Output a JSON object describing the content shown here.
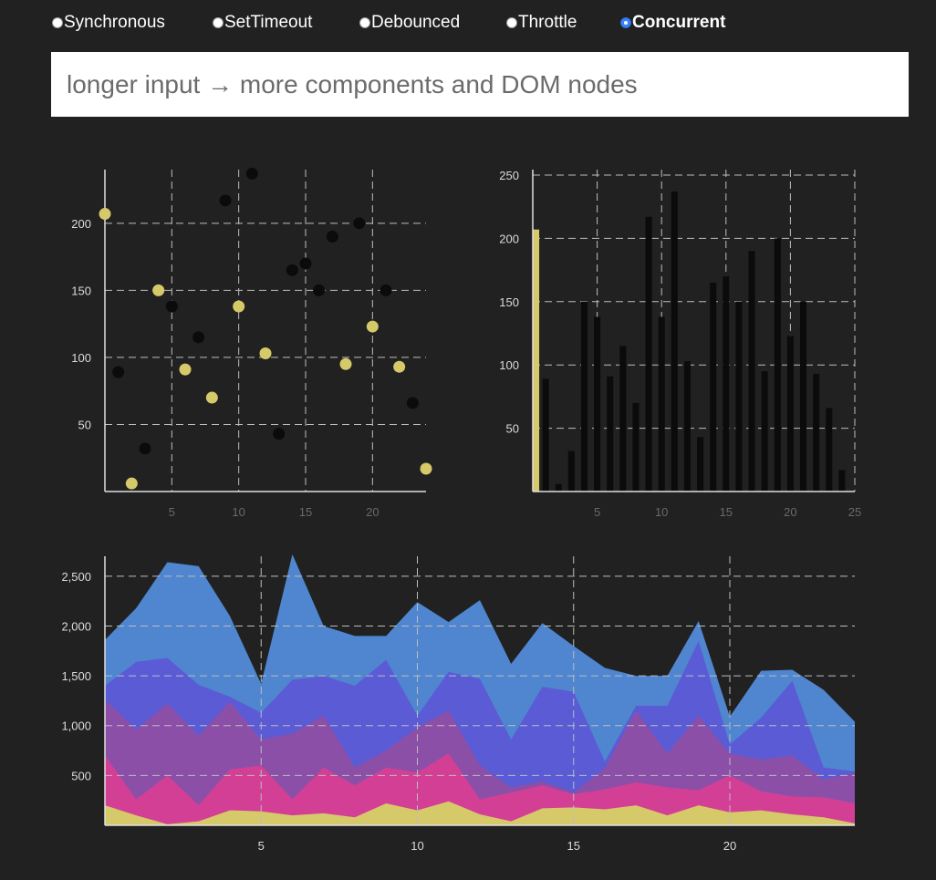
{
  "modes": {
    "options": [
      "Synchronous",
      "SetTimeout",
      "Debounced",
      "Throttle",
      "Concurrent"
    ],
    "selected": "Concurrent"
  },
  "input": {
    "value": "longer input → more components and DOM nodes"
  },
  "colors": {
    "background": "#212121",
    "highlight": "#d6c96a",
    "point": "#0b0b0b",
    "grid": "#bdbdbd",
    "area_layers": [
      "#d6c96a",
      "#d43f96",
      "#8c4fa8",
      "#5b5bd6",
      "#4f86cf"
    ]
  },
  "chart_data": [
    {
      "type": "scatter",
      "xlim": [
        0,
        24
      ],
      "ylim": [
        0,
        240
      ],
      "x_ticks": [
        5,
        10,
        15,
        20
      ],
      "y_ticks": [
        50,
        100,
        150,
        200
      ],
      "grid": true,
      "points": [
        {
          "x": 0,
          "y": 207,
          "highlight": true
        },
        {
          "x": 1,
          "y": 89,
          "highlight": false
        },
        {
          "x": 2,
          "y": 6,
          "highlight": true
        },
        {
          "x": 3,
          "y": 32,
          "highlight": false
        },
        {
          "x": 4,
          "y": 150,
          "highlight": true
        },
        {
          "x": 5,
          "y": 138,
          "highlight": false
        },
        {
          "x": 6,
          "y": 91,
          "highlight": true
        },
        {
          "x": 7,
          "y": 115,
          "highlight": false
        },
        {
          "x": 8,
          "y": 70,
          "highlight": true
        },
        {
          "x": 9,
          "y": 217,
          "highlight": false
        },
        {
          "x": 10,
          "y": 138,
          "highlight": true
        },
        {
          "x": 11,
          "y": 237,
          "highlight": false
        },
        {
          "x": 12,
          "y": 103,
          "highlight": true
        },
        {
          "x": 13,
          "y": 43,
          "highlight": false
        },
        {
          "x": 14,
          "y": 165,
          "highlight": false
        },
        {
          "x": 15,
          "y": 170,
          "highlight": false
        },
        {
          "x": 16,
          "y": 150,
          "highlight": false
        },
        {
          "x": 17,
          "y": 190,
          "highlight": false
        },
        {
          "x": 18,
          "y": 95,
          "highlight": true
        },
        {
          "x": 19,
          "y": 200,
          "highlight": false
        },
        {
          "x": 20,
          "y": 123,
          "highlight": true
        },
        {
          "x": 21,
          "y": 150,
          "highlight": false
        },
        {
          "x": 22,
          "y": 93,
          "highlight": true
        },
        {
          "x": 23,
          "y": 66,
          "highlight": false
        },
        {
          "x": 24,
          "y": 17,
          "highlight": true
        }
      ]
    },
    {
      "type": "bar",
      "xlim": [
        0,
        25
      ],
      "ylim": [
        0,
        250
      ],
      "x_ticks": [
        5,
        10,
        15,
        20,
        25
      ],
      "y_ticks": [
        50,
        100,
        150,
        200,
        250
      ],
      "grid": true,
      "highlight_index": 0,
      "values": [
        207,
        89,
        6,
        32,
        150,
        138,
        91,
        115,
        70,
        217,
        138,
        237,
        103,
        43,
        165,
        170,
        150,
        190,
        95,
        200,
        123,
        150,
        93,
        66,
        17
      ]
    },
    {
      "type": "area",
      "stacked": true,
      "xlim": [
        0,
        24
      ],
      "ylim": [
        0,
        2700
      ],
      "x_ticks": [
        5,
        10,
        15,
        20
      ],
      "y_ticks": [
        500,
        1000,
        1500,
        2000,
        2500
      ],
      "y_tick_labels": [
        "500",
        "1,000",
        "1,500",
        "2,000",
        "2,500"
      ],
      "grid": true,
      "x": [
        0,
        1,
        2,
        3,
        4,
        5,
        6,
        7,
        8,
        9,
        10,
        11,
        12,
        13,
        14,
        15,
        16,
        17,
        18,
        19,
        20,
        21,
        22,
        23,
        24
      ],
      "cumulative_series": [
        {
          "values": [
            200,
            100,
            10,
            40,
            150,
            140,
            100,
            120,
            80,
            220,
            150,
            240,
            110,
            40,
            170,
            180,
            160,
            200,
            100,
            200,
            130,
            150,
            110,
            80,
            20
          ]
        },
        {
          "values": [
            700,
            260,
            500,
            200,
            560,
            600,
            260,
            580,
            400,
            580,
            530,
            720,
            260,
            330,
            400,
            310,
            360,
            430,
            380,
            350,
            500,
            340,
            290,
            280,
            220
          ]
        },
        {
          "values": [
            1260,
            960,
            1220,
            900,
            1240,
            860,
            920,
            1100,
            580,
            750,
            980,
            1150,
            600,
            380,
            440,
            330,
            570,
            1150,
            720,
            1100,
            720,
            660,
            700,
            460,
            520
          ]
        },
        {
          "values": [
            1400,
            1640,
            1680,
            1410,
            1290,
            1130,
            1460,
            1500,
            1400,
            1660,
            1100,
            1540,
            1470,
            860,
            1390,
            1340,
            640,
            1200,
            1200,
            1850,
            810,
            1080,
            1450,
            580,
            540
          ]
        },
        {
          "values": [
            1860,
            2180,
            2640,
            2600,
            2100,
            1420,
            2720,
            2000,
            1900,
            1900,
            2240,
            2040,
            2260,
            1620,
            2030,
            1800,
            1580,
            1500,
            1500,
            2050,
            1090,
            1550,
            1560,
            1360,
            1040
          ]
        }
      ]
    }
  ]
}
